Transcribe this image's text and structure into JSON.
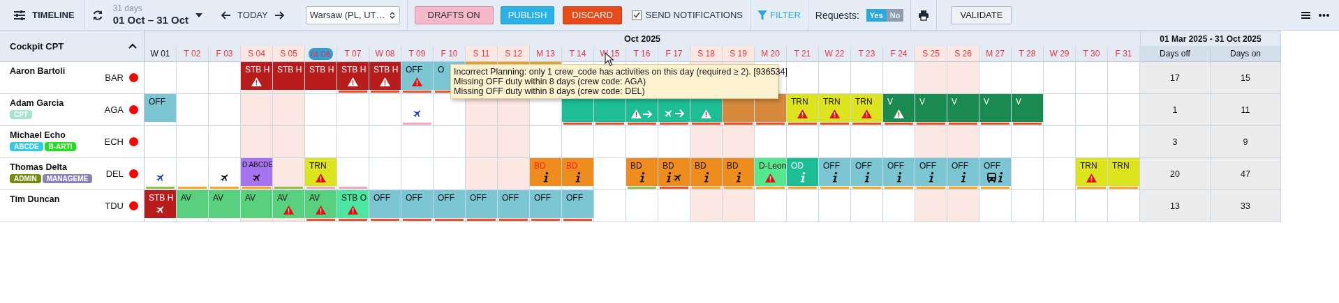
{
  "toolbar": {
    "title": "TIMELINE",
    "range_caption": "31 days",
    "range": "01 Oct – 31 Oct",
    "today": "TODAY",
    "timezone": "Warsaw (PL, UT…",
    "buttons": [
      {
        "label": "DRAFTS ON",
        "kind": "drafts"
      },
      {
        "label": "PUBLISH",
        "kind": "publish"
      },
      {
        "label": "DISCARD",
        "kind": "discard"
      }
    ],
    "notifications": {
      "label": "SEND NOTIFICATIONS",
      "checked": true
    },
    "filter": "FILTER",
    "requests": {
      "label": "Requests:",
      "options": [
        {
          "label": "Yes",
          "selected": true
        },
        {
          "label": "No",
          "selected": false
        }
      ]
    },
    "validate": "VALIDATE"
  },
  "group": {
    "title": "Cockpit CPT",
    "expanded": true
  },
  "month": "Oct 2025",
  "days": [
    {
      "label": "W 01",
      "weekend": false,
      "today": false,
      "alert": false
    },
    {
      "label": "T 02",
      "weekend": false,
      "today": false,
      "alert": true
    },
    {
      "label": "F 03",
      "weekend": false,
      "today": false,
      "alert": true
    },
    {
      "label": "S 04",
      "weekend": true,
      "today": false,
      "alert": true
    },
    {
      "label": "S 05",
      "weekend": true,
      "today": false,
      "alert": true
    },
    {
      "label": "M 06",
      "weekend": false,
      "today": true,
      "alert": true
    },
    {
      "label": "T 07",
      "weekend": false,
      "today": false,
      "alert": true
    },
    {
      "label": "W 08",
      "weekend": false,
      "today": false,
      "alert": true
    },
    {
      "label": "T 09",
      "weekend": false,
      "today": false,
      "alert": true
    },
    {
      "label": "F 10",
      "weekend": false,
      "today": false,
      "alert": true
    },
    {
      "label": "S 11",
      "weekend": true,
      "today": false,
      "alert": true
    },
    {
      "label": "S 12",
      "weekend": true,
      "today": false,
      "alert": true
    },
    {
      "label": "M 13",
      "weekend": false,
      "today": false,
      "alert": true
    },
    {
      "label": "T 14",
      "weekend": false,
      "today": false,
      "alert": true
    },
    {
      "label": "W 15",
      "weekend": false,
      "today": false,
      "alert": true
    },
    {
      "label": "T 16",
      "weekend": false,
      "today": false,
      "alert": true
    },
    {
      "label": "F 17",
      "weekend": false,
      "today": false,
      "alert": true
    },
    {
      "label": "S 18",
      "weekend": true,
      "today": false,
      "alert": true
    },
    {
      "label": "S 19",
      "weekend": true,
      "today": false,
      "alert": true
    },
    {
      "label": "M 20",
      "weekend": false,
      "today": false,
      "alert": true
    },
    {
      "label": "T 21",
      "weekend": false,
      "today": false,
      "alert": true
    },
    {
      "label": "W 22",
      "weekend": false,
      "today": false,
      "alert": true
    },
    {
      "label": "T 23",
      "weekend": false,
      "today": false,
      "alert": true
    },
    {
      "label": "F 24",
      "weekend": false,
      "today": false,
      "alert": true
    },
    {
      "label": "S 25",
      "weekend": true,
      "today": false,
      "alert": true
    },
    {
      "label": "S 26",
      "weekend": true,
      "today": false,
      "alert": true
    },
    {
      "label": "M 27",
      "weekend": false,
      "today": false,
      "alert": true
    },
    {
      "label": "T 28",
      "weekend": false,
      "today": false,
      "alert": true
    },
    {
      "label": "W 29",
      "weekend": false,
      "today": false,
      "alert": true
    },
    {
      "label": "T 30",
      "weekend": false,
      "today": false,
      "alert": true
    },
    {
      "label": "F 31",
      "weekend": false,
      "today": false,
      "alert": true
    }
  ],
  "stats": {
    "period": "01 Mar 2025 - 31 Oct 2025",
    "columns": [
      "Days off",
      "Days on"
    ]
  },
  "crew": [
    {
      "name": "Aaron Bartoli",
      "code": "BAR",
      "color": "#ff0000",
      "stats": [
        "17",
        "15"
      ],
      "cells": [
        {},
        {},
        {},
        {
          "label": "STB H",
          "color": "#b91c1c",
          "icons": [
            {
              "kind": "warning"
            }
          ]
        },
        {
          "label": "STB H",
          "color": "#b91c1c"
        },
        {
          "label": "STB H",
          "color": "#b91c1c"
        },
        {
          "label": "STB H",
          "color": "#b91c1c",
          "icons": [
            {
              "kind": "warning"
            }
          ],
          "bar": {
            "color": "#e8502a"
          }
        },
        {
          "label": "STB H",
          "color": "#b91c1c",
          "icons": [
            {
              "kind": "warning"
            }
          ],
          "bar": {
            "color": "#e8502a"
          }
        },
        {
          "label": "OFF",
          "color": "#7bc6d2",
          "icons": [
            {
              "kind": "warning"
            }
          ],
          "bar": {
            "color": "#e8502a"
          }
        },
        {
          "label": "O",
          "color": "#7bc6d2",
          "bar": {
            "color": "#e8502a"
          }
        },
        {
          "color": "#e2a52a"
        },
        {
          "color": "#e2a52a"
        },
        {
          "color": "#e2a52a"
        },
        {},
        {},
        {},
        {},
        {},
        {},
        {},
        {},
        {},
        {},
        {},
        {},
        {},
        {},
        {},
        {},
        {},
        {}
      ]
    },
    {
      "name": "Adam Garcia",
      "code": "AGA",
      "color": "#ff0000",
      "tags": [
        {
          "label": "CPT",
          "color": "#a6e3cc"
        }
      ],
      "stats": [
        "1",
        "11"
      ],
      "cells": [
        {
          "label": "OFF",
          "color": "#7bc6d2"
        },
        {},
        {},
        {},
        {},
        {},
        {},
        {},
        {
          "icons": [
            {
              "kind": "plane",
              "color": "#1f3fd6"
            }
          ],
          "bar": {
            "color": "#f2a6be"
          }
        },
        {},
        {},
        {},
        {},
        {
          "color": "#1dbd96",
          "bar": {
            "color": "#e8502a"
          }
        },
        {
          "color": "#1dbd96",
          "bar": {
            "color": "#e8502a"
          }
        },
        {
          "color": "#1dbd96",
          "icons": [
            {
              "kind": "warning"
            },
            {
              "kind": "arrow"
            }
          ],
          "bar": {
            "color": "#e8502a"
          }
        },
        {
          "color": "#1dbd96",
          "icons": [
            {
              "kind": "plane"
            },
            {
              "kind": "arrow"
            }
          ],
          "bar": {
            "color": "#e8502a"
          }
        },
        {
          "color": "#1dbd96",
          "icons": [
            {
              "kind": "warning"
            }
          ],
          "bar": {
            "color": "#e8502a"
          }
        },
        {
          "color": "#d4893c",
          "bar": {
            "color": "#e8502a"
          }
        },
        {
          "color": "#d4893c",
          "bar": {
            "color": "#e8502a"
          }
        },
        {
          "label": "TRN",
          "color": "#dde31c",
          "icons": [
            {
              "kind": "warning"
            }
          ],
          "bar": {
            "color": "#e8502a"
          }
        },
        {
          "label": "TRN",
          "color": "#dde31c",
          "icons": [
            {
              "kind": "warning"
            }
          ],
          "bar": {
            "color": "#e8502a"
          }
        },
        {
          "label": "TRN",
          "color": "#dde31c",
          "icons": [
            {
              "kind": "warning"
            }
          ],
          "bar": {
            "color": "#e8502a"
          }
        },
        {
          "label": "V",
          "color": "#1a8a50",
          "icons": [
            {
              "kind": "warning"
            }
          ],
          "bar": {
            "color": "#e8502a"
          }
        },
        {
          "label": "V",
          "color": "#1a8a50",
          "bar": {
            "color": "#e8502a"
          }
        },
        {
          "label": "V",
          "color": "#1a8a50",
          "bar": {
            "color": "#e8502a"
          }
        },
        {
          "label": "V",
          "color": "#1a8a50",
          "bar": {
            "color": "#e8502a"
          }
        },
        {
          "label": "V",
          "color": "#1a8a50",
          "bar": {
            "color": "#e8502a"
          }
        },
        {},
        {},
        {}
      ]
    },
    {
      "name": "Michael Echo",
      "code": "ECH",
      "color": "#ff0000",
      "tags": [
        {
          "label": "ABCDE",
          "color": "#2fcbe3"
        },
        {
          "label": "B-ARTI",
          "color": "#1fe01f"
        }
      ],
      "stats": [
        "3",
        "9"
      ],
      "cells": [
        {},
        {},
        {},
        {},
        {},
        {},
        {},
        {},
        {},
        {},
        {},
        {},
        {},
        {},
        {},
        {},
        {},
        {},
        {},
        {},
        {},
        {},
        {},
        {},
        {},
        {},
        {},
        {},
        {},
        {},
        {}
      ]
    },
    {
      "name": "Thomas Delta",
      "code": "DEL",
      "color": "#ff0000",
      "tags": [
        {
          "label": "ADMIN",
          "color": "#7a8a12"
        },
        {
          "label": "MANAGEME",
          "color": "#8a82b8"
        }
      ],
      "stats": [
        "20",
        "47"
      ],
      "cells": [
        {
          "icons": [
            {
              "kind": "plane",
              "color": "#1f3fd6"
            }
          ],
          "bar": {
            "color": "#8bc34a"
          }
        },
        {
          "bar": {
            "color": "#f5a623"
          }
        },
        {
          "icons": [
            {
              "kind": "plane"
            }
          ],
          "bar": {
            "color": "#f5a623"
          }
        },
        {
          "label": "D ABCDE",
          "color": "#a674ee",
          "icons": [
            {
              "kind": "plane"
            }
          ],
          "bar": {
            "color": "#f5a623"
          }
        },
        {
          "bar": {
            "color": "#8bc34a"
          }
        },
        {
          "label": "TRN",
          "color": "#dde31c",
          "icons": [
            {
              "kind": "warning"
            }
          ],
          "bar": {
            "color": "#f2a6be"
          }
        },
        {
          "bar": {
            "color": "#f2a6be"
          }
        },
        {},
        {},
        {},
        {},
        {},
        {
          "label": "BD",
          "flagged": true,
          "color": "#ef8c1e",
          "icons": [
            {
              "kind": "info"
            }
          ]
        },
        {
          "label": "BD",
          "flagged": true,
          "color": "#ef8c1e",
          "icons": [
            {
              "kind": "info"
            }
          ]
        },
        {},
        {
          "label": "BD",
          "color": "#ef8c1e",
          "icons": [
            {
              "kind": "info"
            }
          ],
          "bar": {
            "color": "#8bc34a"
          }
        },
        {
          "label": "BD",
          "color": "#ef8c1e",
          "icons": [
            {
              "kind": "info"
            },
            {
              "kind": "plane"
            }
          ],
          "bar": {
            "color": "#e8502a"
          }
        },
        {
          "label": "BD",
          "color": "#ef8c1e",
          "icons": [
            {
              "kind": "info"
            }
          ],
          "bar": {
            "color": "#f5a623"
          }
        },
        {
          "label": "BD",
          "color": "#ef8c1e",
          "icons": [
            {
              "kind": "info"
            }
          ],
          "bar": {
            "color": "#f5a623"
          }
        },
        {
          "label": "D-Leon",
          "color": "#55e88f",
          "icons": [
            {
              "kind": "warning"
            }
          ],
          "bar": {
            "color": "#f5a623"
          }
        },
        {
          "label": "OD",
          "color": "#1dbd96",
          "icons": [
            {
              "kind": "info"
            }
          ],
          "bar": {
            "color": "#f5a623"
          }
        },
        {
          "label": "OFF",
          "color": "#7bc6d2",
          "icons": [
            {
              "kind": "info"
            }
          ],
          "bar": {
            "color": "#f5a623"
          }
        },
        {
          "label": "OFF",
          "color": "#7bc6d2",
          "icons": [
            {
              "kind": "info"
            }
          ],
          "bar": {
            "color": "#f5a623"
          }
        },
        {
          "label": "OFF",
          "color": "#7bc6d2",
          "icons": [
            {
              "kind": "info"
            }
          ],
          "bar": {
            "color": "#f5a623"
          }
        },
        {
          "label": "OFF",
          "color": "#7bc6d2",
          "icons": [
            {
              "kind": "info"
            }
          ],
          "bar": {
            "color": "#f5a623"
          }
        },
        {
          "label": "OFF",
          "color": "#7bc6d2",
          "icons": [
            {
              "kind": "info"
            }
          ],
          "bar": {
            "color": "#f5a623"
          }
        },
        {
          "label": "OFF",
          "color": "#7bc6d2",
          "icons": [
            {
              "kind": "bus"
            },
            {
              "kind": "info"
            }
          ],
          "bar": {
            "color": "#f5a623"
          }
        },
        {},
        {},
        {
          "label": "TRN",
          "color": "#dde31c",
          "icons": [
            {
              "kind": "warning"
            }
          ],
          "bar": {
            "color": "#f5a623"
          }
        },
        {
          "label": "TRN",
          "color": "#dde31c",
          "bar": {
            "color": "#f5a623"
          }
        }
      ]
    },
    {
      "name": "Tim Duncan",
      "code": "TDU",
      "color": "#ff0000",
      "stats": [
        "13",
        "33"
      ],
      "cells": [
        {
          "label": "STB H",
          "color": "#b91c1c",
          "icons": [
            {
              "kind": "plane"
            }
          ]
        },
        {
          "label": "AV",
          "color": "#58d07e"
        },
        {
          "label": "AV",
          "color": "#58d07e"
        },
        {
          "label": "AV",
          "color": "#58d07e"
        },
        {
          "label": "AV",
          "color": "#58d07e",
          "icons": [
            {
              "kind": "warning"
            }
          ]
        },
        {
          "label": "AV",
          "color": "#58d07e",
          "icons": [
            {
              "kind": "warning"
            }
          ],
          "bar": {
            "color": "#e8502a"
          }
        },
        {
          "label": "STB O",
          "color": "#4de6a0",
          "icons": [
            {
              "kind": "warning"
            }
          ],
          "bar": {
            "color": "#e8502a"
          }
        },
        {
          "label": "OFF",
          "color": "#7bc6d2",
          "bar": {
            "color": "#e8502a"
          }
        },
        {
          "label": "OFF",
          "color": "#7bc6d2",
          "bar": {
            "color": "#e8502a"
          }
        },
        {
          "label": "OFF",
          "color": "#7bc6d2",
          "bar": {
            "color": "#e8502a"
          }
        },
        {
          "label": "OFF",
          "color": "#7bc6d2",
          "bar": {
            "color": "#e8502a"
          }
        },
        {
          "label": "OFF",
          "color": "#7bc6d2",
          "bar": {
            "color": "#e8502a"
          }
        },
        {
          "label": "OFF",
          "color": "#7bc6d2",
          "bar": {
            "color": "#e8502a"
          }
        },
        {
          "label": "OFF",
          "color": "#7bc6d2",
          "bar": {
            "color": "#e8502a"
          }
        },
        {},
        {},
        {},
        {},
        {},
        {},
        {},
        {},
        {},
        {},
        {},
        {},
        {},
        {},
        {},
        {},
        {}
      ]
    }
  ],
  "tooltip": {
    "lines": [
      "Incorrect Planning: only 1 crew_code has activities on this day (required ≥ 2). [936534]",
      "Missing OFF duty within 8 days (crew code: AGA)",
      "Missing OFF duty within 8 days (crew code: DEL)"
    ]
  }
}
